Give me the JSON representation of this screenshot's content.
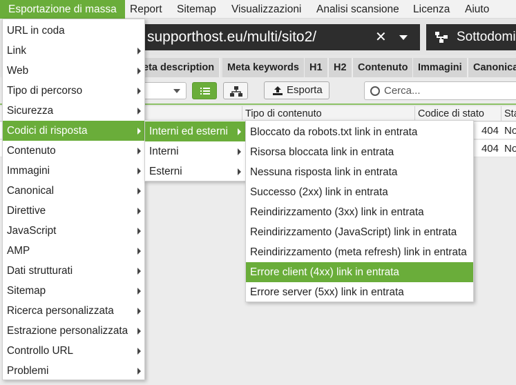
{
  "menubar": {
    "items": [
      {
        "label": "Esportazione di massa",
        "active": true
      },
      {
        "label": "Report"
      },
      {
        "label": "Sitemap"
      },
      {
        "label": "Visualizzazioni"
      },
      {
        "label": "Analisi scansione"
      },
      {
        "label": "Licenza"
      },
      {
        "label": "Aiuto"
      }
    ]
  },
  "urlbar": {
    "url": "supporthost.eu/multi/sito2/",
    "mode_label": "Sottodomin"
  },
  "tabs": [
    "eta description",
    "Meta keywords",
    "H1",
    "H2",
    "Contenuto",
    "Immagini",
    "Canonica"
  ],
  "toolbar": {
    "export_label": "Esporta",
    "search_placeholder": "Cerca..."
  },
  "table": {
    "columns": [
      "Tipo di contenuto",
      "Codice di stato",
      "Sta"
    ],
    "rows": [
      {
        "status_code": "404",
        "status": "No"
      },
      {
        "status_code": "404",
        "status": "No"
      }
    ]
  },
  "menu_main": {
    "items": [
      {
        "label": "URL in coda",
        "submenu": false
      },
      {
        "label": "Link",
        "submenu": true
      },
      {
        "label": "Web",
        "submenu": true
      },
      {
        "label": "Tipo di percorso",
        "submenu": true
      },
      {
        "label": "Sicurezza",
        "submenu": true
      },
      {
        "label": "Codici di risposta",
        "submenu": true,
        "highlighted": true
      },
      {
        "label": "Contenuto",
        "submenu": true
      },
      {
        "label": "Immagini",
        "submenu": true
      },
      {
        "label": "Canonical",
        "submenu": true
      },
      {
        "label": "Direttive",
        "submenu": true
      },
      {
        "label": "JavaScript",
        "submenu": true
      },
      {
        "label": "AMP",
        "submenu": true
      },
      {
        "label": "Dati strutturati",
        "submenu": true
      },
      {
        "label": "Sitemap",
        "submenu": true
      },
      {
        "label": "Ricerca personalizzata",
        "submenu": true
      },
      {
        "label": "Estrazione personalizzata",
        "submenu": true
      },
      {
        "label": "Controllo URL",
        "submenu": true
      },
      {
        "label": "Problemi",
        "submenu": true
      }
    ]
  },
  "menu_sub": {
    "items": [
      {
        "label": "Interni ed esterni",
        "highlighted": true
      },
      {
        "label": "Interni"
      },
      {
        "label": "Esterni"
      }
    ]
  },
  "menu_sub2": {
    "items": [
      {
        "label": "Bloccato da robots.txt link in entrata"
      },
      {
        "label": "Risorsa bloccata link in entrata"
      },
      {
        "label": "Nessuna risposta link in entrata"
      },
      {
        "label": "Successo (2xx) link in entrata"
      },
      {
        "label": "Reindirizzamento (3xx) link in entrata"
      },
      {
        "label": "Reindirizzamento (JavaScript) link in entrata"
      },
      {
        "label": "Reindirizzamento (meta refresh) link in entrata"
      },
      {
        "label": "Errore client (4xx) link in entrata",
        "highlighted": true
      },
      {
        "label": "Errore server (5xx) link in entrata"
      }
    ]
  },
  "colors": {
    "accent": "#6aad3a",
    "dark_bar": "#2d2d2d"
  }
}
